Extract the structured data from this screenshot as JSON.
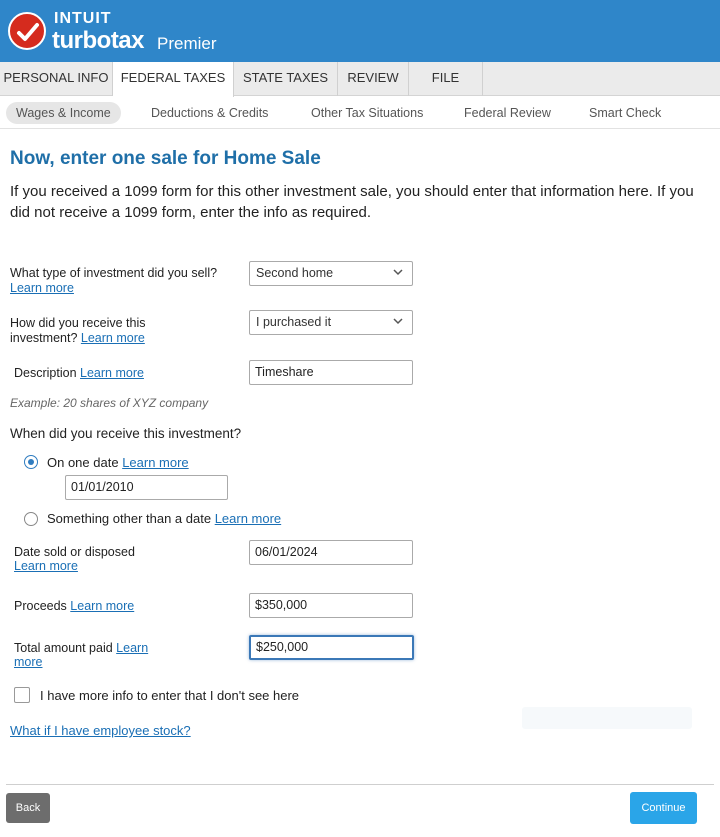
{
  "brand": {
    "company": "INTUIT",
    "product": "turbotax",
    "edition": "Premier"
  },
  "tabs": [
    {
      "label": "PERSONAL INFO"
    },
    {
      "label": "FEDERAL TAXES"
    },
    {
      "label": "STATE TAXES"
    },
    {
      "label": "REVIEW"
    },
    {
      "label": "FILE"
    }
  ],
  "active_tab": "FEDERAL TAXES",
  "subnav": [
    {
      "label": "Wages & Income"
    },
    {
      "label": "Deductions & Credits"
    },
    {
      "label": "Other Tax Situations"
    },
    {
      "label": "Federal Review"
    },
    {
      "label": "Smart Check"
    }
  ],
  "page": {
    "title": "Now, enter one sale for Home Sale",
    "intro": "If you received a 1099 form for this other investment sale, you should enter that information here. If you did not receive a 1099 form, enter the info as required."
  },
  "form": {
    "investment_type": {
      "label": "What type of investment did you sell?",
      "link": "Learn more",
      "value": "Second home"
    },
    "receive_method": {
      "label": "How did you receive this investment?",
      "link": "Learn more",
      "value": "I purchased it"
    },
    "description": {
      "label": "Description",
      "link": "Learn more",
      "value": "Timeshare",
      "example": "Example: 20 shares of XYZ company"
    },
    "receive_date": {
      "question": "When did you receive this investment?",
      "option_one_date": "On one date",
      "option_one_link": "Learn more",
      "date_value": "01/01/2010",
      "option_other": "Something other than a date",
      "option_other_link": "Learn more",
      "selected": "one_date"
    },
    "date_sold": {
      "label": "Date sold or disposed",
      "link": "Learn more",
      "value": "06/01/2024"
    },
    "proceeds": {
      "label": "Proceeds",
      "link": "Learn more",
      "value": "$350,000"
    },
    "total_paid": {
      "label": "Total amount paid",
      "link_part1": "Learn",
      "link_part2": "more",
      "value": "$250,000"
    },
    "more_info": {
      "label": "I have more info to enter that I don't see here",
      "checked": false
    },
    "employee_stock_link": "What if I have employee stock?"
  },
  "footer": {
    "back": "Back",
    "continue": "Continue"
  },
  "colors": {
    "header": "#2f86c9",
    "title": "#1f6fa8",
    "link": "#1a6fb5",
    "continue": "#2aa5e8",
    "back": "#6d6d6d"
  }
}
